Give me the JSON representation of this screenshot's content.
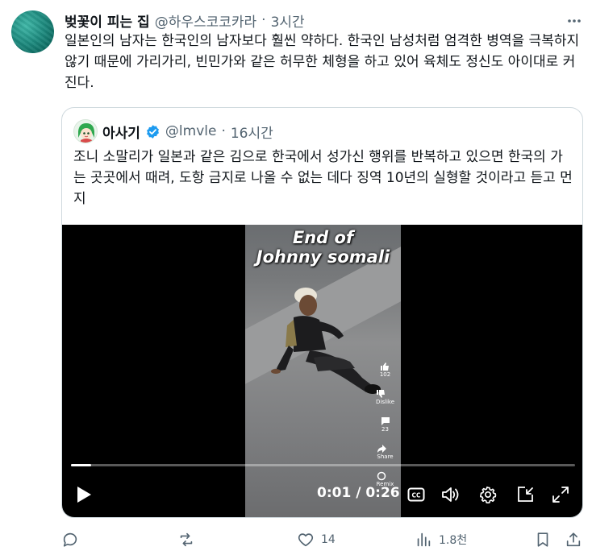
{
  "tweet": {
    "author_name": "벚꽃이 피는 집",
    "handle": "@하우스코코카라",
    "separator": "·",
    "time": "3시간",
    "text": "일본인의 남자는 한국인의 남자보다 훨씬 약하다. 한국인 남성처럼 엄격한 병역을 극복하지 않기 때문에 가리가리, 빈민가와 같은 허무한 체형을 하고 있어 육체도 정신도 아이대로 커진다."
  },
  "quote": {
    "author_name": "아사기",
    "handle": "@lmvle",
    "separator": "·",
    "time": "16시간",
    "text": "조니 소말리가 일본과 같은 김으로 한국에서 성가신 행위를 반복하고 있으면 한국의 가는 곳곳에서 때려, 도항 금지로 나올 수 없는 데다 징역 10년의 실형할 것이라고 듣고 먼지"
  },
  "video": {
    "overlay_title_line1": "End of",
    "overlay_title_line2": "Johnny somali",
    "like_count": "102",
    "dislike_label": "Dislike",
    "comment_count": "23",
    "share_label": "Share",
    "remix_label": "Remix",
    "timecode": "0:01 / 0:26",
    "progress": 0.04
  },
  "actions": {
    "likes": "14",
    "views": "1.8천"
  },
  "colors": {
    "text": "#0f1419",
    "secondary": "#536471",
    "verified": "#1d9bf0",
    "border": "#cfd9de"
  }
}
